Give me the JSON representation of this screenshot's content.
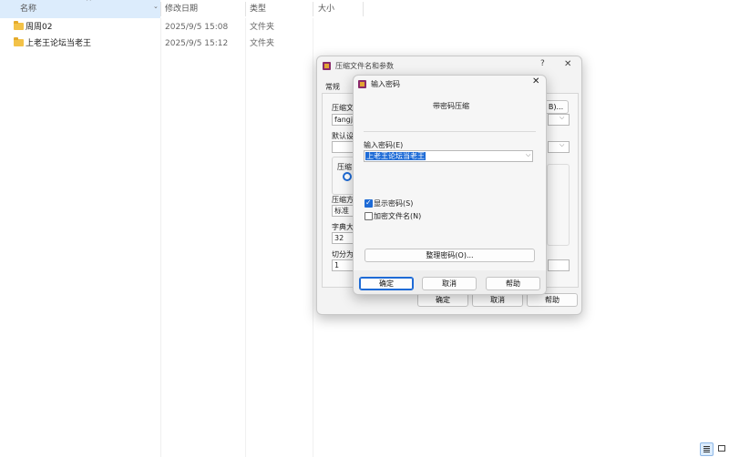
{
  "explorer": {
    "columns": {
      "name": "名称",
      "modified": "修改日期",
      "type": "类型",
      "size": "大小"
    },
    "rows": [
      {
        "name": "周周02",
        "date": "2025/9/5 15:08",
        "type": "文件夹"
      },
      {
        "name": "上老王论坛当老王",
        "date": "2025/9/5 15:12",
        "type": "文件夹"
      }
    ]
  },
  "archive_dialog": {
    "title": "压缩文件名和参数",
    "help_glyph": "?",
    "close_glyph": "✕",
    "tab_general": "常规",
    "archive_name_label": "压缩文",
    "archive_name_value": "fangjia",
    "browse_label": "B)...",
    "profile_label": "默认设",
    "format_label": "压缩",
    "method_label": "压缩方",
    "method_value": "标准",
    "dict_label": "字典大",
    "dict_value": "32",
    "split_label": "切分为",
    "split_value": "1",
    "ok": "确定",
    "cancel": "取消",
    "help": "帮助"
  },
  "password_dialog": {
    "title": "输入密码",
    "close_glyph": "✕",
    "heading": "带密码压缩",
    "password_label": "输入密码(E)",
    "password_value": "上老王论坛当老王",
    "show_password_label": "显示密码(S)",
    "show_password_checked": true,
    "encrypt_names_label": "加密文件名(N)",
    "encrypt_names_checked": false,
    "organize_button": "整理密码(O)...",
    "ok": "确定",
    "cancel": "取消",
    "help": "帮助"
  },
  "colors": {
    "accent": "#1e6bd6",
    "selection": "#cce4f7",
    "folder": "#f3c248"
  }
}
